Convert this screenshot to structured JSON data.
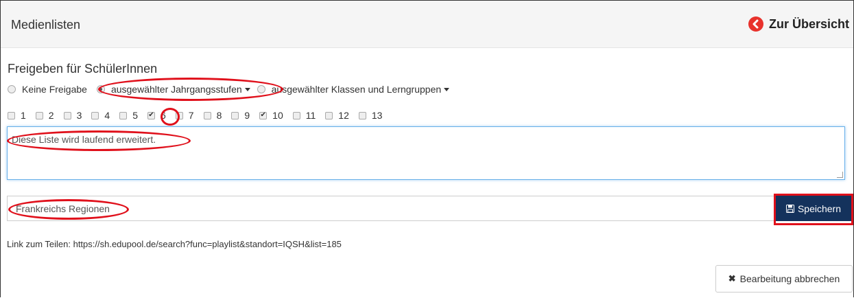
{
  "header": {
    "title": "Medienlisten",
    "back_label": "Zur Übersicht"
  },
  "share": {
    "section_title": "Freigeben für SchülerInnen",
    "options": [
      {
        "label": "Keine Freigabe",
        "checked": false
      },
      {
        "label": "ausgewählter Jahrgangsstufen",
        "checked": true,
        "dropdown": true
      },
      {
        "label": "ausgewählter Klassen und Lerngruppen",
        "checked": false,
        "dropdown": true
      }
    ],
    "grades": [
      {
        "label": "1",
        "checked": false
      },
      {
        "label": "2",
        "checked": false
      },
      {
        "label": "3",
        "checked": false
      },
      {
        "label": "4",
        "checked": false
      },
      {
        "label": "5",
        "checked": false
      },
      {
        "label": "6",
        "checked": true
      },
      {
        "label": "7",
        "checked": false
      },
      {
        "label": "8",
        "checked": false
      },
      {
        "label": "9",
        "checked": false
      },
      {
        "label": "10",
        "checked": true
      },
      {
        "label": "11",
        "checked": false
      },
      {
        "label": "12",
        "checked": false
      },
      {
        "label": "13",
        "checked": false
      }
    ]
  },
  "description": {
    "value": "Diese Liste wird laufend erweitert."
  },
  "list_name": {
    "value": "Frankreichs Regionen",
    "save_label": "Speichern"
  },
  "share_link": {
    "text": "Link zum Teilen: https://sh.edupool.de/search?func=playlist&standort=IQSH&list=185"
  },
  "cancel": {
    "label": "Bearbeitung abbrechen"
  },
  "colors": {
    "accent": "#14325c",
    "highlight": "#e0101b",
    "back_icon": "#e8322c"
  }
}
